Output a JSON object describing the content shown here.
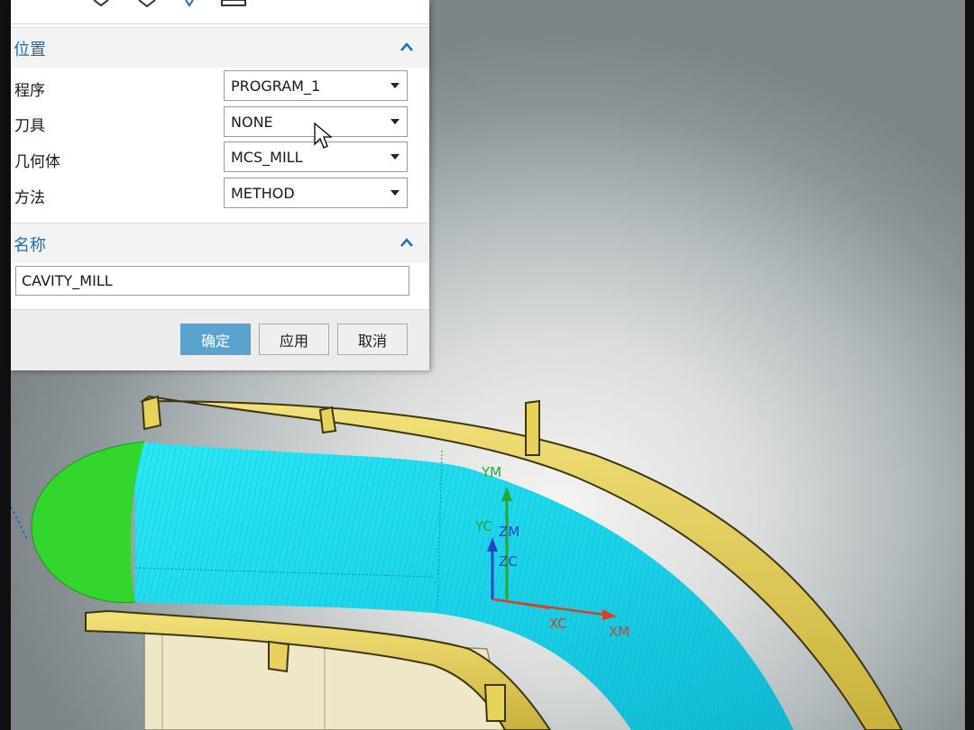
{
  "dialog": {
    "position_section": {
      "title": "位置",
      "fields": [
        {
          "label": "程序",
          "value": "PROGRAM_1"
        },
        {
          "label": "刀具",
          "value": "NONE"
        },
        {
          "label": "几何体",
          "value": "MCS_MILL"
        },
        {
          "label": "方法",
          "value": "METHOD"
        }
      ]
    },
    "name_section": {
      "title": "名称",
      "value": "CAVITY_MILL"
    },
    "buttons": {
      "ok": "确定",
      "apply": "应用",
      "cancel": "取消"
    }
  },
  "viewport": {
    "axes": {
      "ym": "YM",
      "yc": "YC",
      "zm": "ZM",
      "zc": "ZC",
      "xc": "XC",
      "xm": "XM"
    }
  },
  "colors": {
    "accent": "#1e6fb0",
    "primary_button": "#5aa3cf",
    "part_yellow": "#e8d35a",
    "toolpath_cyan": "#1fe0f0",
    "toolpath_green": "#2fd62a"
  }
}
